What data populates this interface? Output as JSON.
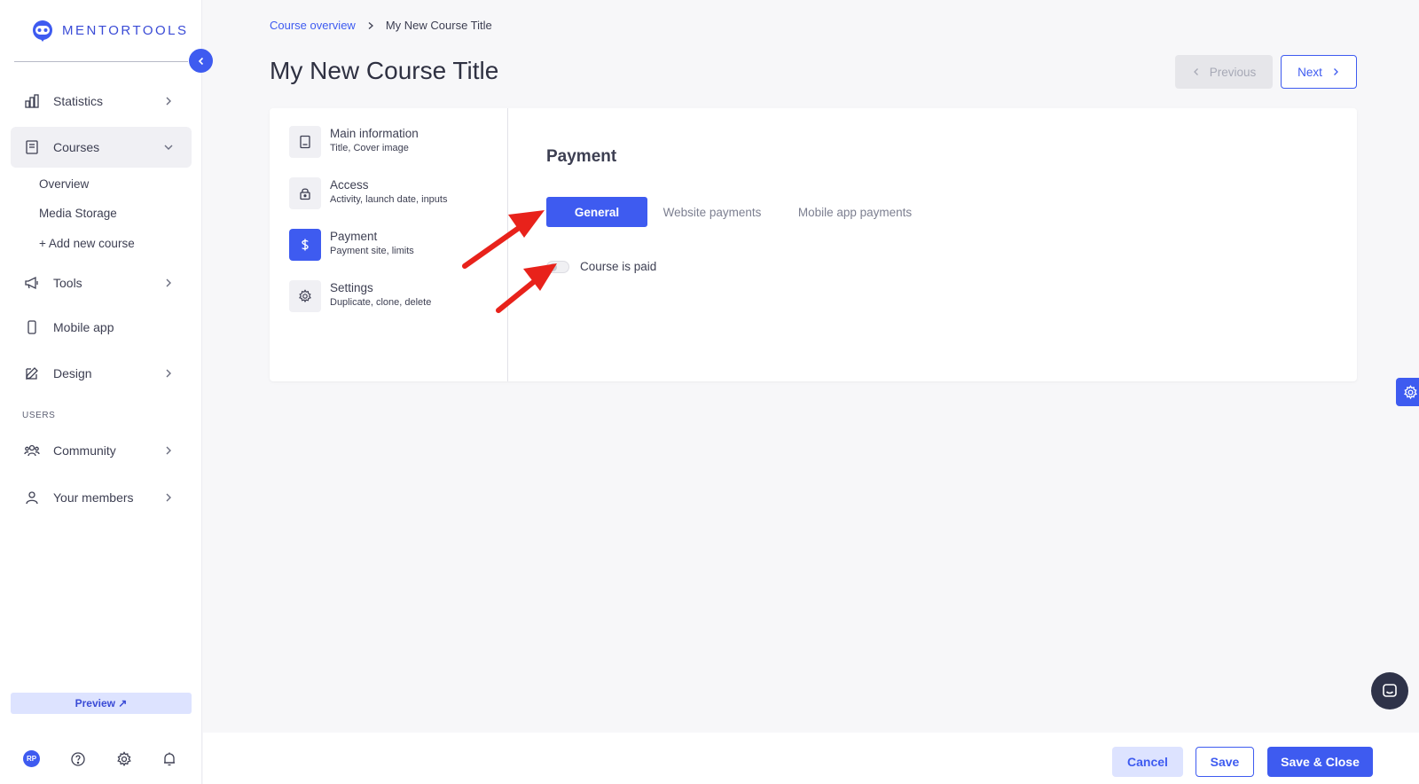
{
  "brand": {
    "name": "MENTORTOOLS",
    "color": "#3e5bf0"
  },
  "sidebar": {
    "items": [
      {
        "label": "Statistics",
        "icon": "bar-chart-icon"
      },
      {
        "label": "Courses",
        "icon": "book-icon"
      },
      {
        "label": "Tools",
        "icon": "megaphone-icon"
      },
      {
        "label": "Mobile app",
        "icon": "mobile-icon"
      },
      {
        "label": "Design",
        "icon": "pencil-icon"
      },
      {
        "label": "Community",
        "icon": "people-icon"
      },
      {
        "label": "Your members",
        "icon": "user-icon"
      }
    ],
    "courses_sub": [
      "Overview",
      "Media Storage",
      "+ Add new course"
    ],
    "section_users": "USERS",
    "preview_label": "Preview ↗",
    "avatar_initials": "RP"
  },
  "breadcrumb": {
    "parent": "Course overview",
    "current": "My New Course Title"
  },
  "page_title": "My New Course Title",
  "nav_buttons": {
    "previous": "Previous",
    "next": "Next"
  },
  "steps": [
    {
      "title": "Main information",
      "subtitle": "Title, Cover image",
      "icon": "document-icon"
    },
    {
      "title": "Access",
      "subtitle": "Activity, launch date, inputs",
      "icon": "lock-icon"
    },
    {
      "title": "Payment",
      "subtitle": "Payment site, limits",
      "icon": "dollar-icon"
    },
    {
      "title": "Settings",
      "subtitle": "Duplicate, clone, delete",
      "icon": "gear-icon"
    }
  ],
  "panel": {
    "title": "Payment",
    "tabs": [
      "General",
      "Website payments",
      "Mobile app payments"
    ],
    "active_tab": "General",
    "toggle_label": "Course is paid",
    "toggle_on": false
  },
  "footer": {
    "cancel": "Cancel",
    "save": "Save",
    "save_close": "Save & Close"
  },
  "annotation_color": "#e8221b"
}
